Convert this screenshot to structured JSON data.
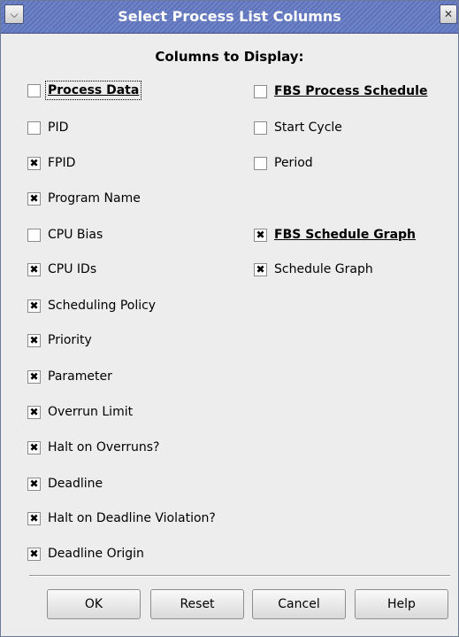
{
  "window": {
    "title": "Select Process List Columns",
    "menu_icon": "chevron-down-icon",
    "close_icon": "close-icon"
  },
  "heading": "Columns to Display:",
  "left_column": [
    {
      "label": "Process Data",
      "checked": false,
      "group_header": true,
      "focused": true
    },
    {
      "label": "PID",
      "checked": false
    },
    {
      "label": "FPID",
      "checked": true
    },
    {
      "label": "Program Name",
      "checked": true
    },
    {
      "label": "CPU Bias",
      "checked": false
    },
    {
      "label": "CPU IDs",
      "checked": true
    },
    {
      "label": "Scheduling Policy",
      "checked": true
    },
    {
      "label": "Priority",
      "checked": true
    },
    {
      "label": "Parameter",
      "checked": true
    },
    {
      "label": "Overrun Limit",
      "checked": true
    },
    {
      "label": "Halt on Overruns?",
      "checked": true
    },
    {
      "label": "Deadline",
      "checked": true
    },
    {
      "label": "Halt on Deadline Violation?",
      "checked": true
    },
    {
      "label": "Deadline Origin",
      "checked": true
    }
  ],
  "right_column": [
    {
      "label": "FBS Process Schedule",
      "checked": false,
      "group_header": true
    },
    {
      "label": "Start Cycle",
      "checked": false
    },
    {
      "label": "Period",
      "checked": false
    },
    {
      "label": "FBS Schedule Graph",
      "checked": true,
      "group_header": true
    },
    {
      "label": "Schedule Graph",
      "checked": true
    }
  ],
  "buttons": {
    "ok": "OK",
    "reset": "Reset",
    "cancel": "Cancel",
    "help": "Help"
  }
}
